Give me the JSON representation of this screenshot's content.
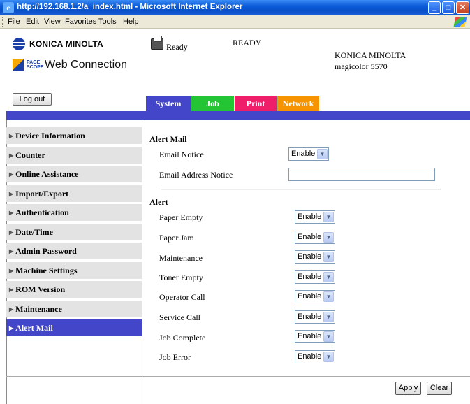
{
  "window": {
    "title": "http://192.168.1.2/a_index.html - Microsoft Internet Explorer"
  },
  "menu": [
    "File",
    "Edit",
    "View",
    "Favorites",
    "Tools",
    "Help"
  ],
  "logos": {
    "konica": "KONICA MINOLTA",
    "pagescope_small": "PAGE SCOPE",
    "webconnection": "Web Connection"
  },
  "header": {
    "logout_label": "Log out",
    "status_icon_text": "Ready",
    "status_text": "READY",
    "brand_line1": "KONICA MINOLTA",
    "brand_line2": "magicolor 5570"
  },
  "tabs": [
    {
      "label": "System",
      "color": "#4346c9"
    },
    {
      "label": "Job",
      "color": "#23c534"
    },
    {
      "label": "Print",
      "color": "#ef1e6a"
    },
    {
      "label": "Network",
      "color": "#f59400"
    }
  ],
  "sidebar": {
    "items": [
      {
        "label": "Device Information"
      },
      {
        "label": "Counter"
      },
      {
        "label": "Online Assistance"
      },
      {
        "label": "Import/Export"
      },
      {
        "label": "Authentication"
      },
      {
        "label": "Date/Time"
      },
      {
        "label": "Admin Password"
      },
      {
        "label": "Machine Settings"
      },
      {
        "label": "ROM Version"
      },
      {
        "label": "Maintenance"
      },
      {
        "label": "Alert Mail"
      }
    ],
    "active_index": 10
  },
  "alert_mail": {
    "title": "Alert Mail",
    "email_notice_label": "Email Notice",
    "email_notice_value": "Enable",
    "email_address_label": "Email Address Notice",
    "email_address_value": ""
  },
  "alert": {
    "title": "Alert",
    "rows": [
      {
        "label": "Paper Empty",
        "value": "Enable"
      },
      {
        "label": "Paper Jam",
        "value": "Enable"
      },
      {
        "label": "Maintenance",
        "value": "Enable"
      },
      {
        "label": "Toner Empty",
        "value": "Enable"
      },
      {
        "label": "Operator Call",
        "value": "Enable"
      },
      {
        "label": "Service Call",
        "value": "Enable"
      },
      {
        "label": "Job Complete",
        "value": "Enable"
      },
      {
        "label": "Job Error",
        "value": "Enable"
      }
    ]
  },
  "buttons": {
    "apply": "Apply",
    "clear": "Clear"
  }
}
